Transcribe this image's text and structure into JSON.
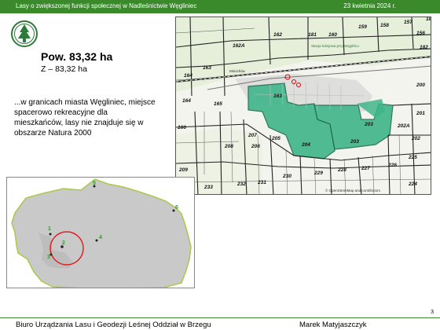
{
  "header": {
    "title": "Lasy o zwiększonej funkcji społecznej w Nadleśnictwie Węgliniec",
    "date": "23 kwietnia 2024 r."
  },
  "content": {
    "area_title": "Pow. 83,32 ha",
    "area_sub": "Z – 83,32 ha",
    "description": "...w granicach miasta Węgliniec, miejsce spacerowo rekreacyjne dla mieszkańców, lasy nie znajduje się w obszarze Natura 2000"
  },
  "map": {
    "compartments": [
      "162",
      "181",
      "160",
      "159",
      "158",
      "157",
      "156",
      "162A",
      "163",
      "164",
      "165",
      "166",
      "164",
      "208",
      "207",
      "206",
      "205",
      "204",
      "203",
      "202A",
      "202",
      "201",
      "200",
      "209",
      "233",
      "232",
      "231",
      "230",
      "229",
      "228",
      "227",
      "226",
      "225",
      "224",
      "182",
      "18"
    ],
    "station_label": "Stacja kolejowa przy Węglińcu",
    "road_label": "Mniszków",
    "copyright": "© OpenStreetMap and contributors"
  },
  "overview": {
    "markers": [
      "1",
      "2",
      "3",
      "4",
      "5",
      "6"
    ]
  },
  "footer": {
    "org": "Biuro Urządzania Lasu i Geodezji Leśnej Oddział w Brzegu",
    "author": "Marek Matyjaszczyk",
    "page": "3"
  },
  "colors": {
    "header_green": "#3a8a2c",
    "forest_highlight": "#3fb58a",
    "overview_fill": "#c9c9c9",
    "overview_border": "#a8c94a",
    "focus_circle": "#e02020"
  }
}
